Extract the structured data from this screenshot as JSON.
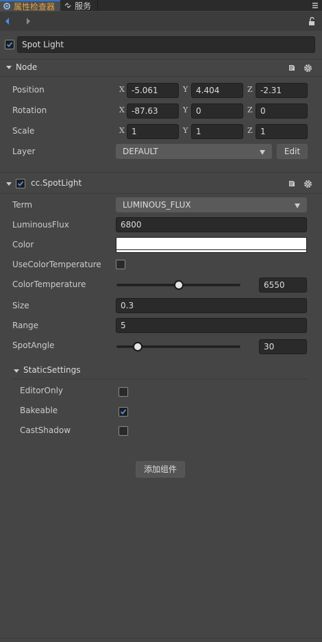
{
  "tabs": [
    {
      "label": "属性检查器",
      "active": true,
      "icon": "gear-icon"
    },
    {
      "label": "服务",
      "active": false,
      "icon": "link-icon"
    }
  ],
  "node": {
    "active": true,
    "name": "Spot Light"
  },
  "node_section": {
    "title": "Node",
    "position": {
      "label": "Position",
      "x": "-5.061",
      "y": "4.404",
      "z": "-2.31"
    },
    "rotation": {
      "label": "Rotation",
      "x": "-87.63",
      "y": "0",
      "z": "0"
    },
    "scale": {
      "label": "Scale",
      "x": "1",
      "y": "1",
      "z": "1"
    },
    "layer": {
      "label": "Layer",
      "value": "DEFAULT",
      "edit_label": "Edit"
    }
  },
  "axes": {
    "x": "X",
    "y": "Y",
    "z": "Z"
  },
  "spotlight": {
    "title": "cc.SpotLight",
    "enabled": true,
    "term": {
      "label": "Term",
      "value": "LUMINOUS_FLUX"
    },
    "luminous_flux": {
      "label": "LuminousFlux",
      "value": "6800"
    },
    "color": {
      "label": "Color",
      "value": "#ffffff"
    },
    "use_color_temperature": {
      "label": "UseColorTemperature",
      "checked": false
    },
    "color_temperature": {
      "label": "ColorTemperature",
      "value": "6550",
      "slider_fraction": 0.5
    },
    "size": {
      "label": "Size",
      "value": "0.3"
    },
    "range": {
      "label": "Range",
      "value": "5"
    },
    "spot_angle": {
      "label": "SpotAngle",
      "value": "30",
      "slider_fraction": 0.17
    },
    "static_settings": {
      "title": "StaticSettings",
      "editor_only": {
        "label": "EditorOnly",
        "checked": false
      },
      "bakeable": {
        "label": "Bakeable",
        "checked": true
      },
      "cast_shadow": {
        "label": "CastShadow",
        "checked": false
      }
    }
  },
  "add_component_label": "添加组件",
  "colors": {
    "accent_tab_text": "#e6a33b",
    "accent_blue": "#2f73c8",
    "background": "#454545"
  }
}
